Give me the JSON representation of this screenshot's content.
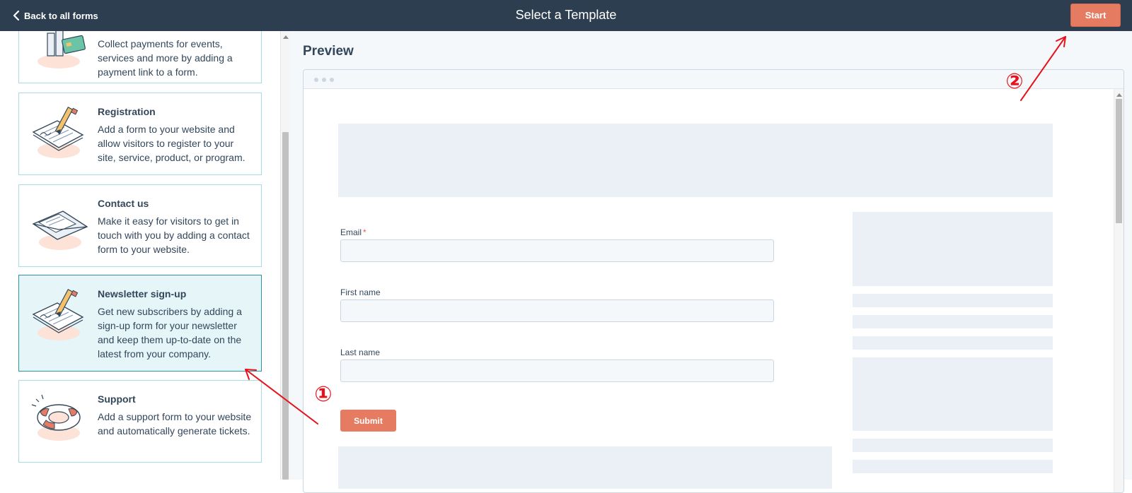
{
  "topbar": {
    "back_label": "Back to all forms",
    "title": "Select a Template",
    "start_label": "Start",
    "icons": {
      "back": "chevron-left-icon"
    }
  },
  "templates": [
    {
      "id": "payments",
      "title": "",
      "description": "Collect payments for events, services and more by adding a payment link to a form.",
      "icon": "payment-card-illustration",
      "selected": false
    },
    {
      "id": "registration",
      "title": "Registration",
      "description": "Add a form to your website and allow visitors to register to your site, service, product, or program.",
      "icon": "signed-document-illustration",
      "selected": false
    },
    {
      "id": "contact",
      "title": "Contact us",
      "description": "Make it easy for visitors to get in touch with you by adding a contact form to your website.",
      "icon": "envelope-illustration",
      "selected": false
    },
    {
      "id": "newsletter",
      "title": "Newsletter sign-up",
      "description": "Get new subscribers by adding a sign-up form for your newsletter and keep them up-to-date on the latest from your company.",
      "icon": "signed-document-illustration",
      "selected": true
    },
    {
      "id": "support",
      "title": "Support",
      "description": "Add a support form to your website and automatically generate tickets.",
      "icon": "lifebuoy-illustration",
      "selected": false
    }
  ],
  "preview": {
    "heading": "Preview",
    "fields": [
      {
        "label": "Email",
        "required": true,
        "required_mark": "*",
        "value": ""
      },
      {
        "label": "First name",
        "required": false,
        "required_mark": "",
        "value": ""
      },
      {
        "label": "Last name",
        "required": false,
        "required_mark": "",
        "value": ""
      }
    ],
    "submit_label": "Submit"
  },
  "annotations": {
    "marker_1": "①",
    "marker_2": "②",
    "color": "#e8101a"
  },
  "colors": {
    "topbar": "#2d3e50",
    "accent": "#e57c62",
    "card_border": "#a8dce3",
    "card_selected_bg": "#e5f5f8",
    "card_selected_border": "#2e93a3",
    "placeholder": "#eaf0f6"
  }
}
